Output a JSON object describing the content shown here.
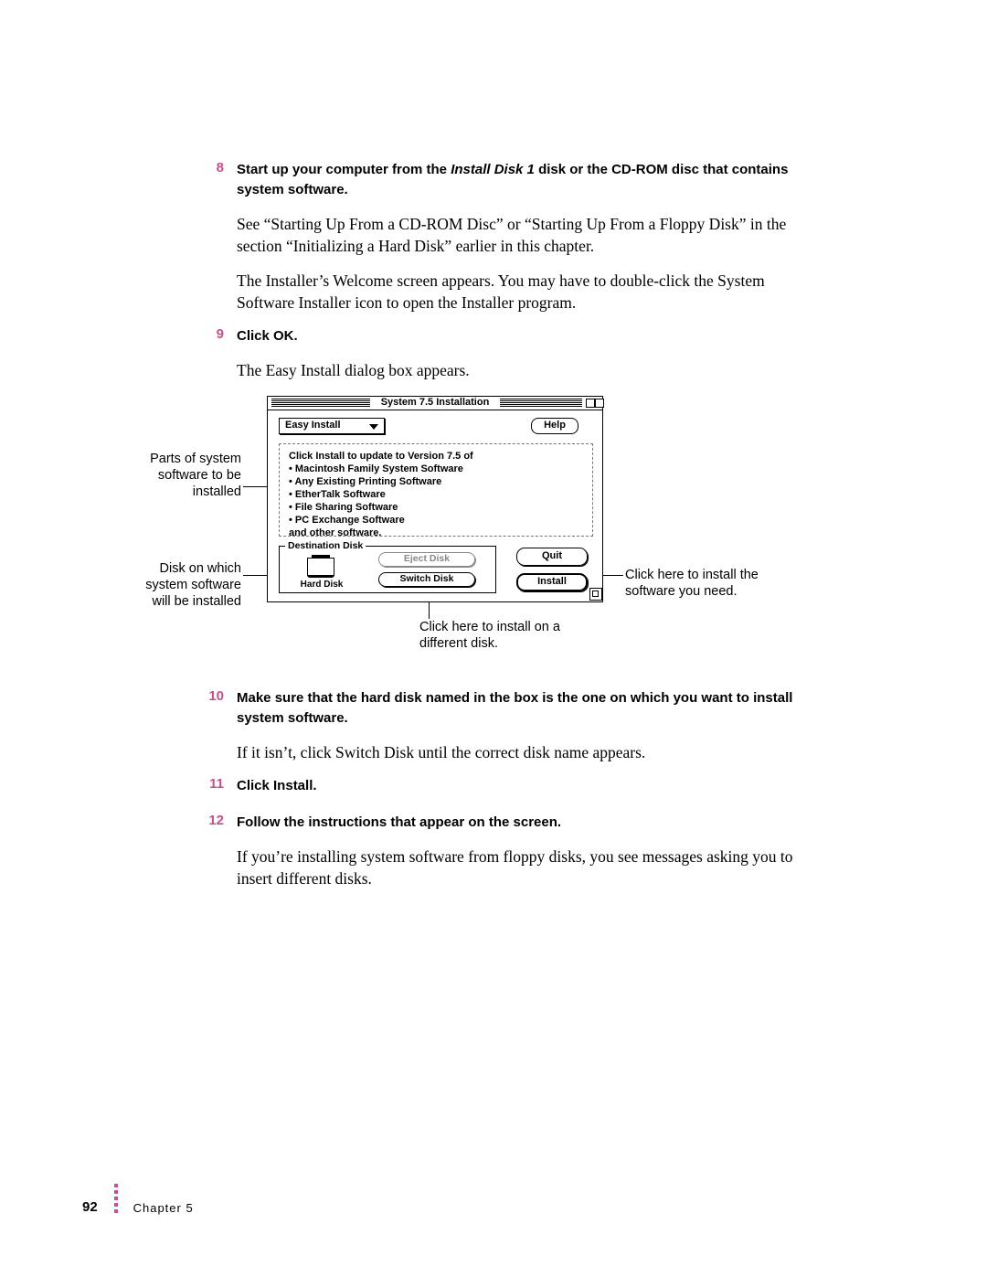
{
  "steps": {
    "s8": {
      "num": "8",
      "head_before": "Start up your computer from the ",
      "head_italic": "Install Disk 1",
      "head_after": " disk or the CD-ROM disc that contains system software.",
      "para1": "See “Starting Up From a CD-ROM Disc” or “Starting Up From a Floppy Disk” in the section “Initializing a Hard Disk” earlier in this chapter.",
      "para2": "The Installer’s Welcome screen appears. You may have to double-click the System Software Installer icon to open the Installer program."
    },
    "s9": {
      "num": "9",
      "head": "Click OK.",
      "para1": "The Easy Install dialog box appears."
    },
    "s10": {
      "num": "10",
      "head": "Make sure that the hard disk named in the box is the one on which you want to install system software.",
      "para1": "If it isn’t, click Switch Disk until the correct disk name appears."
    },
    "s11": {
      "num": "11",
      "head": "Click Install."
    },
    "s12": {
      "num": "12",
      "head": "Follow the instructions that appear on the screen.",
      "para1": "If you’re installing system software from floppy disks, you see messages asking you to insert different disks."
    }
  },
  "callouts": {
    "left1": "Parts of system software to be installed",
    "left2": "Disk on which system software will be installed",
    "right1": "Click here to install the software you need.",
    "bottom": "Click here to install on a different disk."
  },
  "dialog": {
    "title": "System 7.5 Installation",
    "popup": "Easy Install",
    "help": "Help",
    "dash_intro": "Click Install to update to Version 7.5 of",
    "items": [
      "Macintosh Family System Software",
      "Any Existing Printing Software",
      "EtherTalk Software",
      "File Sharing Software",
      "PC Exchange Software"
    ],
    "dash_outro": "and other software.",
    "dest_legend": "Destination Disk",
    "disk_name": "Hard Disk",
    "eject": "Eject Disk",
    "switch": "Switch Disk",
    "quit": "Quit",
    "install": "Install"
  },
  "footer": {
    "page": "92",
    "chapter": "Chapter 5"
  }
}
